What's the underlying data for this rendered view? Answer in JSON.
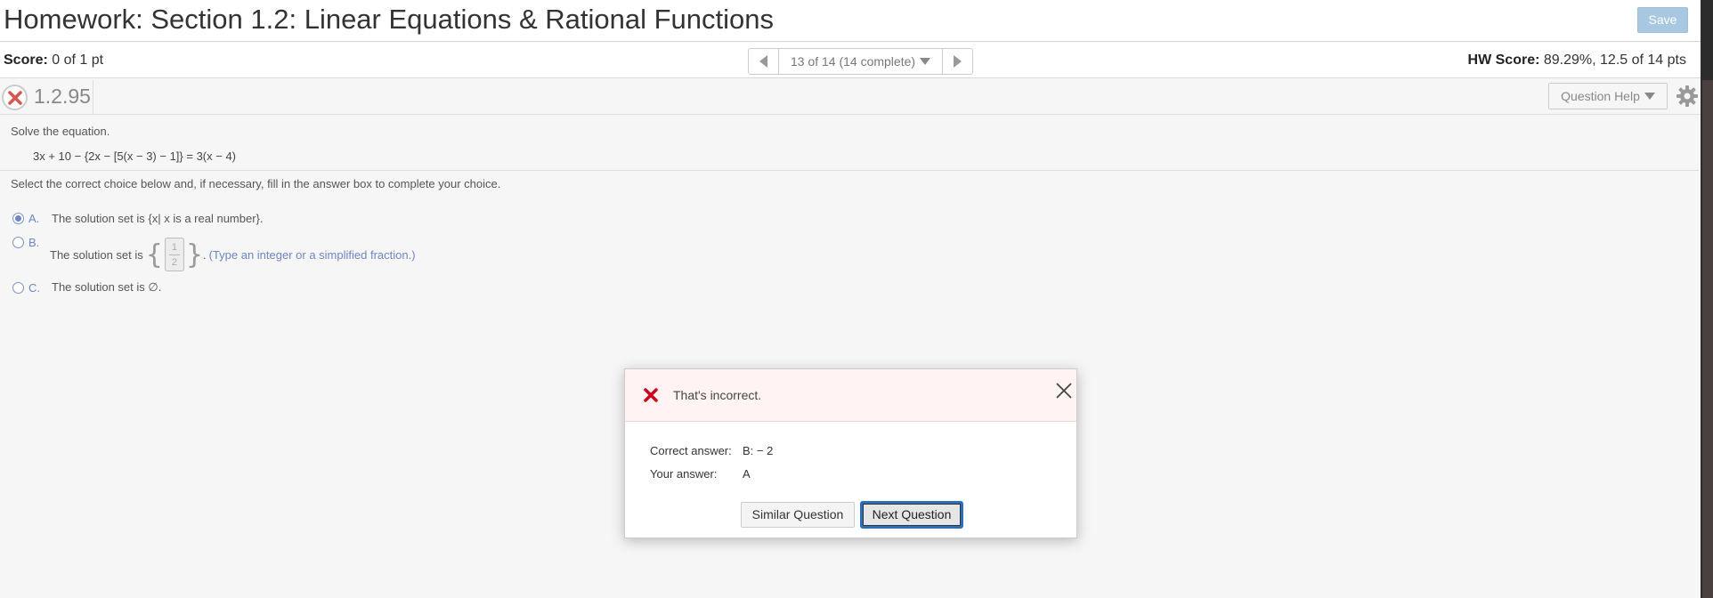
{
  "header": {
    "title": "Homework: Section 1.2: Linear Equations & Rational Functions",
    "save_label": "Save"
  },
  "score_bar": {
    "score_label": "Score:",
    "score_value": "0 of 1 pt",
    "nav_position": "13 of 14 (14 complete)",
    "hw_score_label": "HW Score:",
    "hw_score_value": "89.29%, 12.5 of 14 pts"
  },
  "question": {
    "number": "1.2.95",
    "help_label": "Question Help",
    "instruction": "Solve the equation.",
    "equation": "3x + 10 − {2x − [5(x − 3) − 1]} = 3(x − 4)",
    "select_instruction": "Select the correct choice below and, if necessary, fill in the answer box to complete your choice.",
    "choices": [
      {
        "letter": "A.",
        "text": "The solution set is {x| x is a real number}.",
        "selected": true
      },
      {
        "letter": "B.",
        "text_before": "The solution set is",
        "frac_num": "1",
        "frac_den": "2",
        "text_after": ".",
        "hint": "(Type an integer or a simplified fraction.)",
        "selected": false
      },
      {
        "letter": "C.",
        "text": "The solution set is ∅.",
        "selected": false
      }
    ]
  },
  "modal": {
    "title": "That's incorrect.",
    "correct_label": "Correct answer:",
    "correct_value": "B:  − 2",
    "your_label": "Your answer:",
    "your_value": "A",
    "similar_label": "Similar Question",
    "next_label": "Next Question"
  },
  "colors": {
    "accent": "#6e86c5",
    "error_red": "#d0021b",
    "save_button": "#a8c8e2",
    "focus_blue": "#2a6fb8"
  },
  "icons": {
    "status": "x-circle-icon",
    "settings": "gear-icon",
    "error": "red-x-icon",
    "close": "close-icon"
  }
}
